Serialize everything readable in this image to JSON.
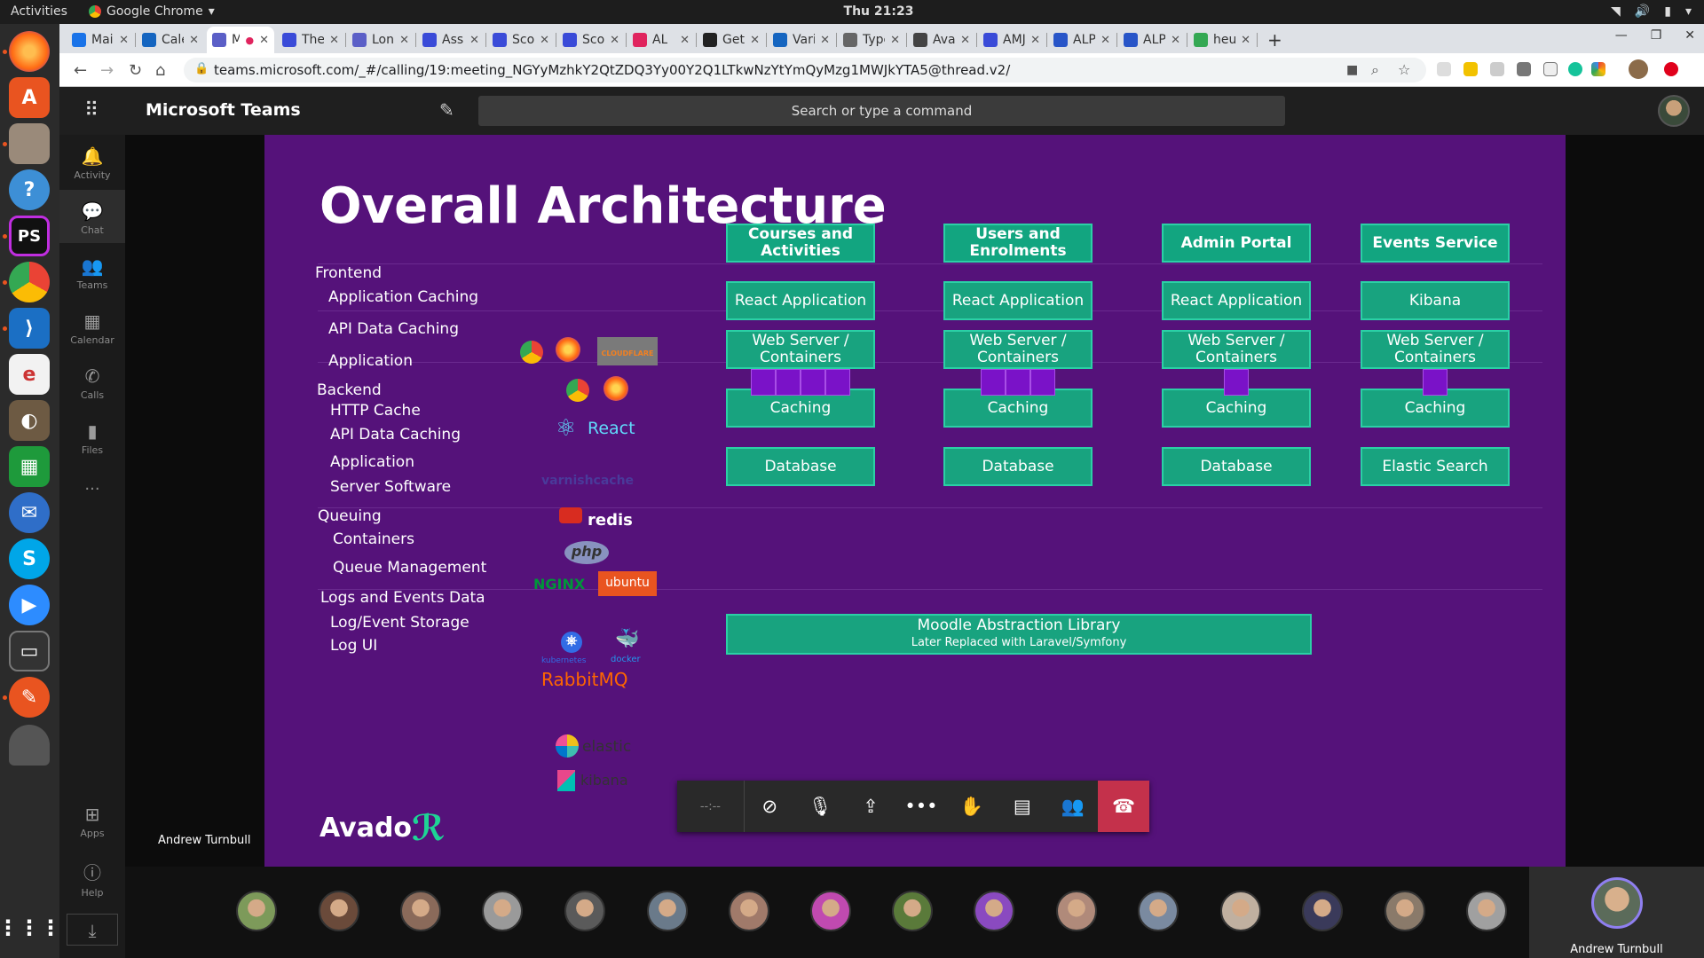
{
  "os": {
    "activities": "Activities",
    "app_name": "Google Chrome",
    "clock": "Thu 21:23"
  },
  "browser": {
    "tabs": [
      {
        "label": "Mail",
        "color": "#1a73e8"
      },
      {
        "label": "Caler",
        "color": "#1565c0"
      },
      {
        "label": "M",
        "color": "#5b5fc7"
      },
      {
        "label": "The C",
        "color": "#3a4bd8"
      },
      {
        "label": "Lond",
        "color": "#5b5fc7"
      },
      {
        "label": "Assig",
        "color": "#3a4bd8"
      },
      {
        "label": "Scop",
        "color": "#3a4bd8"
      },
      {
        "label": "Scop",
        "color": "#3a4bd8"
      },
      {
        "label": "AL",
        "color": "#e0245e"
      },
      {
        "label": "Getti",
        "color": "#222222"
      },
      {
        "label": "Varia",
        "color": "#1565c0"
      },
      {
        "label": "Type",
        "color": "#666666"
      },
      {
        "label": "Avac",
        "color": "#444444"
      },
      {
        "label": "AMJ",
        "color": "#3a4bd8"
      },
      {
        "label": "ALP",
        "color": "#2855c8"
      },
      {
        "label": "ALP",
        "color": "#2855c8"
      },
      {
        "label": "heur",
        "color": "#34a853"
      }
    ],
    "url": "teams.microsoft.com/_#/calling/19:meeting_NGYyMzhkY2QtZDQ3Yy00Y2Q1LTkwNzYtYmQyMzg1MWJkYTA5@thread.v2/"
  },
  "teams": {
    "title": "Microsoft Teams",
    "search_placeholder": "Search or type a command",
    "rail": [
      "Activity",
      "Chat",
      "Teams",
      "Calendar",
      "Calls",
      "Files",
      "...",
      "Apps",
      "Help"
    ],
    "presenter": "Andrew Turnbull",
    "timer": "--:--",
    "self_name": "Andrew Turnbull"
  },
  "slide": {
    "title": "Overall Architecture",
    "sections": [
      {
        "label": "Frontend",
        "items": [
          "Application Caching",
          "API Data Caching",
          "Application"
        ]
      },
      {
        "label": "Backend",
        "items": [
          "HTTP Cache",
          "API Data Caching",
          "Application",
          "Server Software"
        ]
      },
      {
        "label": "Queuing",
        "items": [
          "Containers",
          "Queue Management"
        ]
      },
      {
        "label": "Logs and Events Data",
        "items": [
          "Log/Event Storage",
          "Log UI"
        ]
      }
    ],
    "logos": {
      "cloudflare": "CLOUDFLARE",
      "react": "React",
      "varnish": "varnishcache",
      "redis": "redis",
      "php": "php",
      "nginx": "NGINX",
      "ubuntu": "ubuntu",
      "kubernetes": "kubernetes",
      "docker": "docker",
      "rabbitmq": "RabbitMQ",
      "elastic": "elastic",
      "kibana": "kibana",
      "avado": "Avado"
    },
    "columns": [
      {
        "header": "Courses and Activities",
        "app": "React Application",
        "web": "Web Server / Containers",
        "cache": "Caching",
        "db": "Database",
        "containers": 4
      },
      {
        "header": "Users and Enrolments",
        "app": "React Application",
        "web": "Web Server / Containers",
        "cache": "Caching",
        "db": "Database",
        "containers": 3
      },
      {
        "header": "Admin Portal",
        "app": "React Application",
        "web": "Web Server / Containers",
        "cache": "Caching",
        "db": "Database",
        "containers": 1
      },
      {
        "header": "Events Service",
        "app": "Kibana",
        "web": "Web Server / Containers",
        "cache": "Caching",
        "db": "Elastic Search",
        "containers": 1
      }
    ],
    "library": {
      "line1": "Moodle Abstraction Library",
      "line2": "Later Replaced with Laravel/Symfony"
    }
  },
  "colors": {
    "slide_bg": "#55127a",
    "cell": "#18a37f",
    "container": "#7a12c8",
    "hangup": "#c4314b"
  }
}
